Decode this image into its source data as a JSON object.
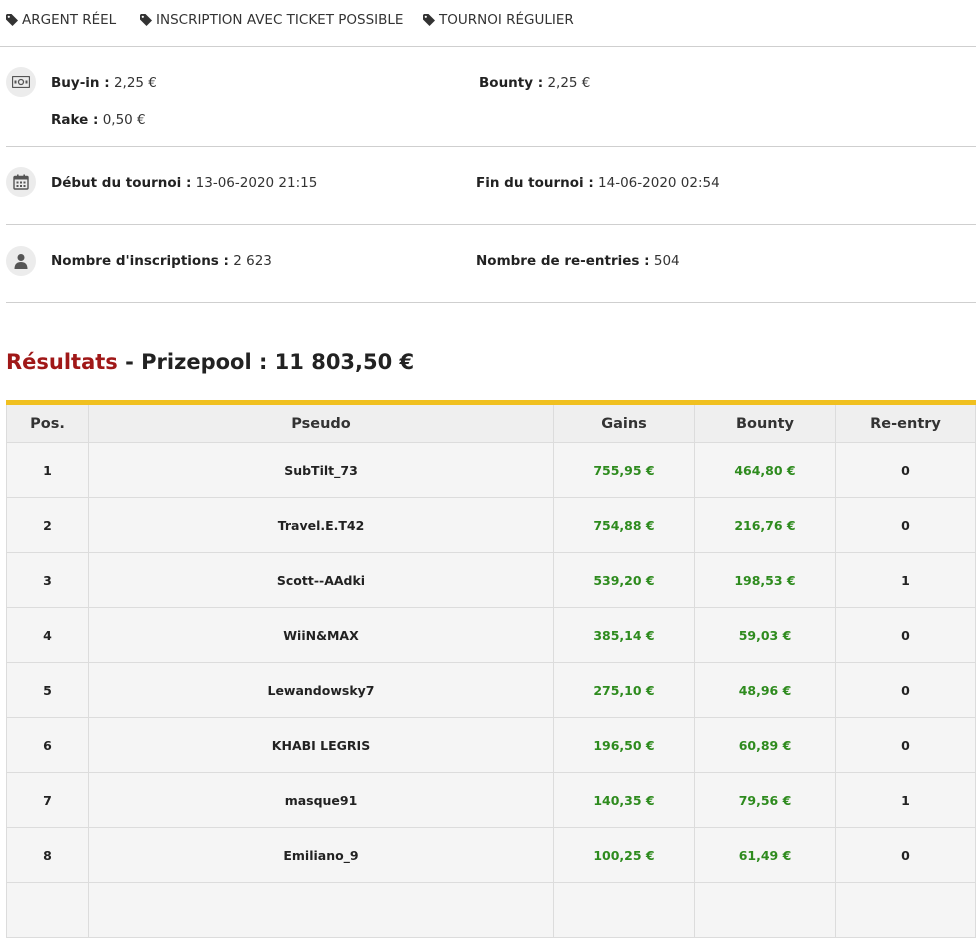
{
  "tags": [
    "ARGENT RÉEL",
    "INSCRIPTION AVEC TICKET POSSIBLE",
    "TOURNOI RÉGULIER"
  ],
  "info": {
    "buyin_label": "Buy-in :",
    "buyin_value": "2,25 €",
    "bounty_label": "Bounty :",
    "bounty_value": "2,25 €",
    "rake_label": "Rake :",
    "rake_value": "0,50 €",
    "start_label": "Début du tournoi :",
    "start_value": "13-06-2020 21:15",
    "end_label": "Fin du tournoi :",
    "end_value": "14-06-2020 02:54",
    "entries_label": "Nombre d'inscriptions :",
    "entries_value": "2 623",
    "reentries_label": "Nombre de re-entries :",
    "reentries_value": "504"
  },
  "results": {
    "title": "Résultats",
    "separator": " - ",
    "prizepool": "Prizepool : 11 803,50 €"
  },
  "table": {
    "headers": [
      "Pos.",
      "Pseudo",
      "Gains",
      "Bounty",
      "Re-entry"
    ],
    "rows": [
      [
        "1",
        "SubTilt_73",
        "755,95 €",
        "464,80 €",
        "0"
      ],
      [
        "2",
        "Travel.E.T42",
        "754,88 €",
        "216,76 €",
        "0"
      ],
      [
        "3",
        "Scott--AAdki",
        "539,20 €",
        "198,53 €",
        "1"
      ],
      [
        "4",
        "WiiN&MAX",
        "385,14 €",
        "59,03 €",
        "0"
      ],
      [
        "5",
        "Lewandowsky7",
        "275,10 €",
        "48,96 €",
        "0"
      ],
      [
        "6",
        "KHABI LEGRIS",
        "196,50 €",
        "60,89 €",
        "0"
      ],
      [
        "7",
        "masque91",
        "140,35 €",
        "79,56 €",
        "1"
      ],
      [
        "8",
        "Emiliano_9",
        "100,25 €",
        "61,49 €",
        "0"
      ]
    ]
  },
  "colors": {
    "accent_red": "#a01818",
    "table_top_border": "#f0c020",
    "money_green": "#2e8b1e"
  }
}
